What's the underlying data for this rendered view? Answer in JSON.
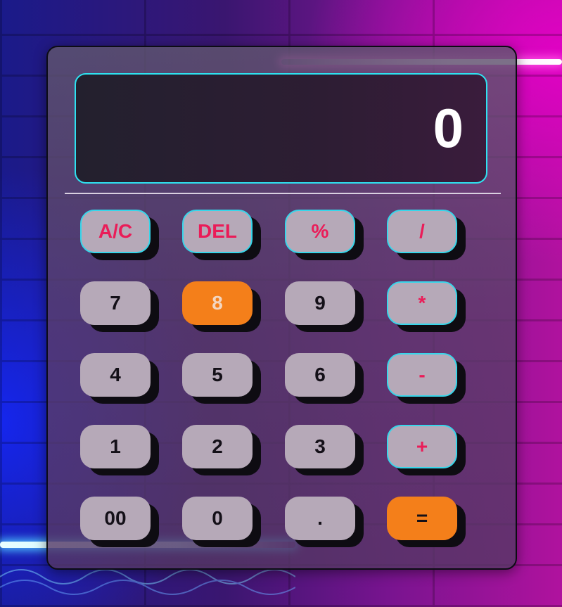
{
  "display": {
    "value": "0"
  },
  "keys": [
    {
      "label": "A/C",
      "style": "op"
    },
    {
      "label": "DEL",
      "style": "op"
    },
    {
      "label": "%",
      "style": "op"
    },
    {
      "label": "/",
      "style": "op"
    },
    {
      "label": "7",
      "style": "num"
    },
    {
      "label": "8",
      "style": "accent-highlight"
    },
    {
      "label": "9",
      "style": "num"
    },
    {
      "label": "*",
      "style": "op"
    },
    {
      "label": "4",
      "style": "num"
    },
    {
      "label": "5",
      "style": "num"
    },
    {
      "label": "6",
      "style": "num"
    },
    {
      "label": "-",
      "style": "op"
    },
    {
      "label": "1",
      "style": "num"
    },
    {
      "label": "2",
      "style": "num"
    },
    {
      "label": "3",
      "style": "num"
    },
    {
      "label": "+",
      "style": "op"
    },
    {
      "label": "00",
      "style": "num"
    },
    {
      "label": "0",
      "style": "num"
    },
    {
      "label": ".",
      "style": "num"
    },
    {
      "label": "=",
      "style": "accent"
    }
  ],
  "colors": {
    "display_border": "#2ee2f0",
    "operator_text": "#ea1c58",
    "operator_border": "#37d6ea",
    "number_key": "#b6a9b8",
    "accent_key": "#f47f1a"
  }
}
